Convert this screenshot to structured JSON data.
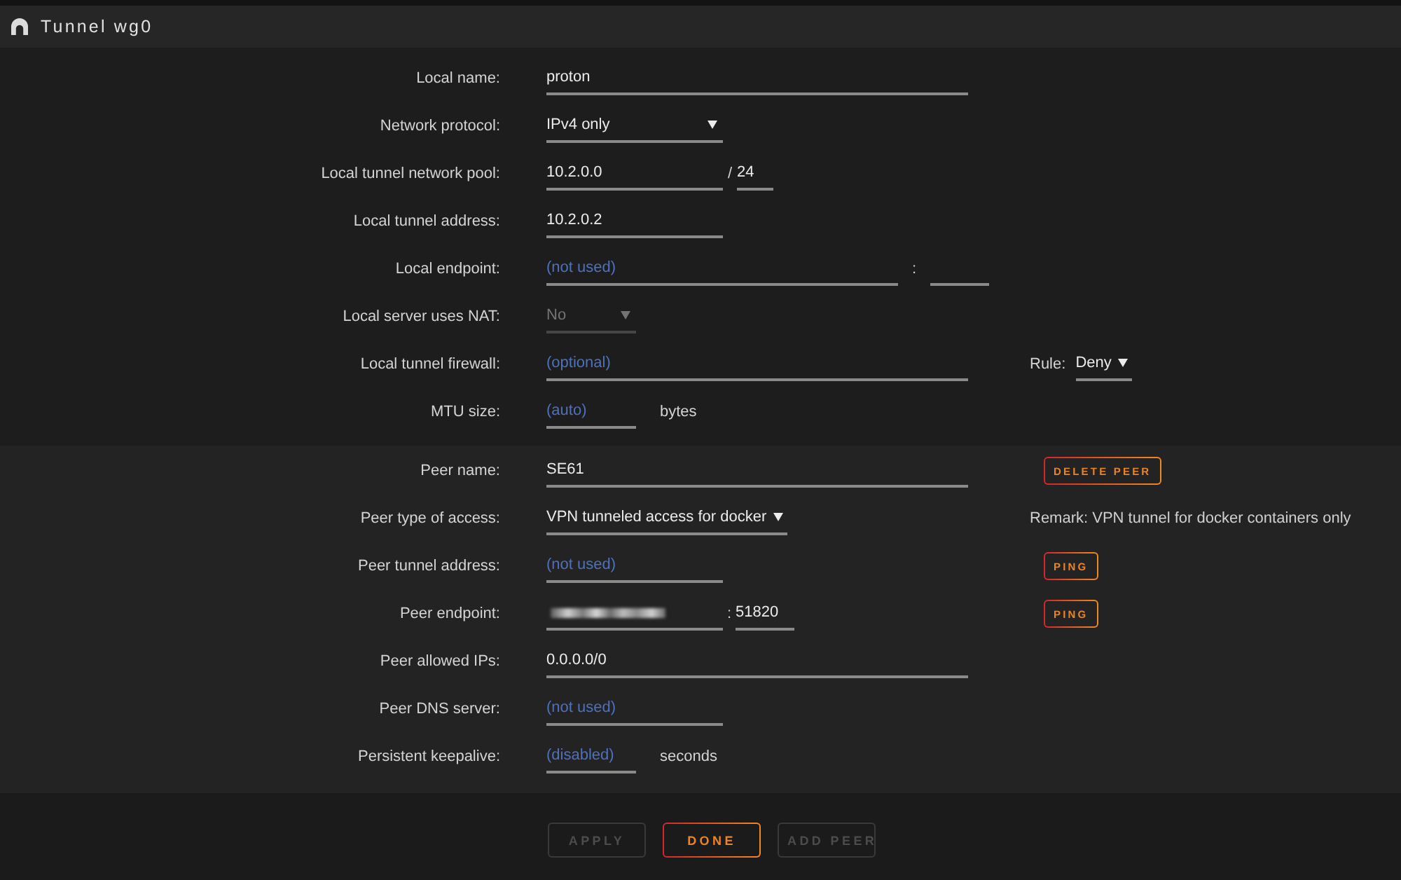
{
  "header": {
    "title": "Tunnel wg0"
  },
  "sections": [
    {
      "kind": "local",
      "rows": [
        {
          "label": "Local name:",
          "controls": [
            {
              "kind": "input",
              "value": "proton"
            }
          ]
        },
        {
          "label": "Network protocol:",
          "controls": [
            {
              "kind": "select",
              "value": "IPv4 only",
              "disabled": false
            }
          ]
        },
        {
          "label": "Local tunnel network pool:",
          "controls": [
            {
              "kind": "input",
              "value": "10.2.0.0"
            },
            {
              "kind": "separator",
              "text": "/"
            },
            {
              "kind": "input",
              "value": "24"
            }
          ]
        },
        {
          "label": "Local tunnel address:",
          "controls": [
            {
              "kind": "input",
              "value": "10.2.0.2"
            }
          ]
        },
        {
          "label": "Local endpoint:",
          "controls": [
            {
              "kind": "input",
              "placeholder": "(not used)"
            },
            {
              "kind": "separator",
              "text": ":"
            },
            {
              "kind": "input"
            }
          ]
        },
        {
          "label": "Local server uses NAT:",
          "controls": [
            {
              "kind": "select",
              "value": "No",
              "disabled": true
            }
          ]
        },
        {
          "label": "Local tunnel firewall:",
          "controls": [
            {
              "kind": "input",
              "placeholder": "(optional)"
            }
          ],
          "aside": [
            {
              "kind": "labeled_select",
              "label": "Rule:",
              "value": "Deny"
            }
          ]
        },
        {
          "label": "MTU size:",
          "controls": [
            {
              "kind": "input",
              "placeholder": "(auto)"
            },
            {
              "kind": "unit",
              "text": "bytes"
            }
          ]
        }
      ]
    },
    {
      "kind": "peer",
      "rows": [
        {
          "label": "Peer name:",
          "controls": [
            {
              "kind": "input",
              "value": "SE61"
            }
          ],
          "aside": [
            {
              "kind": "button",
              "label": "DELETE PEER",
              "disabled": false
            }
          ]
        },
        {
          "label": "Peer type of access:",
          "controls": [
            {
              "kind": "select",
              "value": "VPN tunneled access for docker",
              "disabled": false
            }
          ],
          "aside": [
            {
              "kind": "remark",
              "text": "Remark: VPN tunnel for docker containers only"
            }
          ]
        },
        {
          "label": "Peer tunnel address:",
          "controls": [
            {
              "kind": "input",
              "placeholder": "(not used)"
            }
          ],
          "aside": [
            {
              "kind": "button",
              "label": "PING",
              "disabled": false
            }
          ]
        },
        {
          "label": "Peer endpoint:",
          "controls": [
            {
              "kind": "input",
              "redacted": true
            },
            {
              "kind": "separator",
              "text": ":"
            },
            {
              "kind": "input",
              "value": "51820"
            }
          ],
          "aside": [
            {
              "kind": "button",
              "label": "PING",
              "disabled": false
            }
          ]
        },
        {
          "label": "Peer allowed IPs:",
          "controls": [
            {
              "kind": "input",
              "value": "0.0.0.0/0"
            }
          ]
        },
        {
          "label": "Peer DNS server:",
          "controls": [
            {
              "kind": "input",
              "placeholder": "(not used)"
            }
          ]
        },
        {
          "label": "Persistent keepalive:",
          "controls": [
            {
              "kind": "input",
              "placeholder": "(disabled)"
            },
            {
              "kind": "unit",
              "text": "seconds"
            }
          ]
        }
      ]
    }
  ],
  "footer": {
    "buttons": [
      {
        "label": "APPLY",
        "disabled": true
      },
      {
        "label": "DONE",
        "disabled": false
      },
      {
        "label": "ADD PEER",
        "disabled": true
      }
    ]
  }
}
